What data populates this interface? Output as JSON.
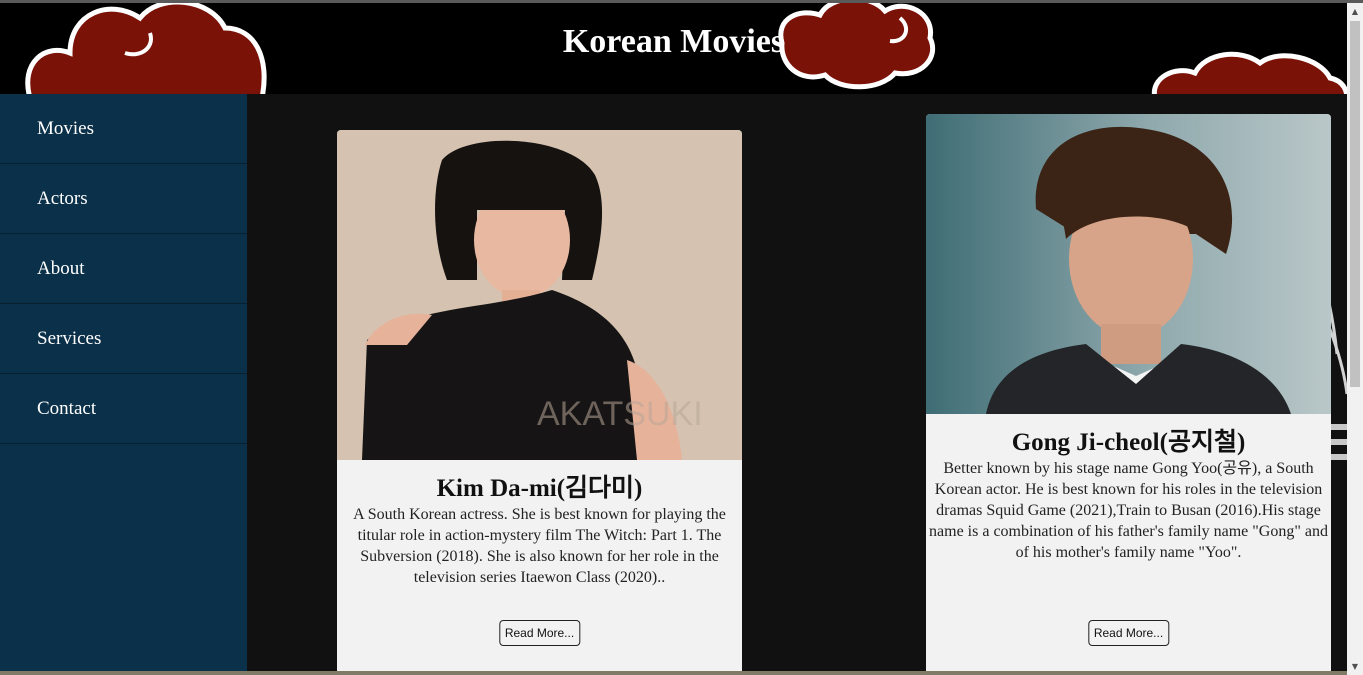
{
  "header": {
    "title": "Korean Movies"
  },
  "sidebar": {
    "items": [
      {
        "label": "Movies"
      },
      {
        "label": "Actors"
      },
      {
        "label": "About"
      },
      {
        "label": "Services"
      },
      {
        "label": "Contact"
      }
    ]
  },
  "cards": [
    {
      "name": "Kim Da-mi(김다미)",
      "description": "A South Korean actress. She is best known for playing the titular role in action-mystery film The Witch: Part 1. The Subversion (2018). She is also known for her role in the television series Itaewon Class (2020)..",
      "button_label": "Read More...",
      "photo_watermark": "AKATSUKI"
    },
    {
      "name": "Gong Ji-cheol(공지철)",
      "description": "Better known by his stage name Gong Yoo(공유), a South Korean actor. He is best known for his roles in the television dramas Squid Game (2021),Train to Busan (2016).His stage name is a combination of his father's family name \"Gong\" and of his mother's family name \"Yoo\".",
      "button_label": "Read More..."
    }
  ],
  "colors": {
    "header_bg": "#000000",
    "cloud_red": "#7a1208",
    "sidebar_bg": "#0b3049",
    "main_bg": "#111111",
    "card_bg": "#f2f2f2"
  },
  "icons": {
    "scroll_up": "▲",
    "scroll_down": "▼"
  }
}
